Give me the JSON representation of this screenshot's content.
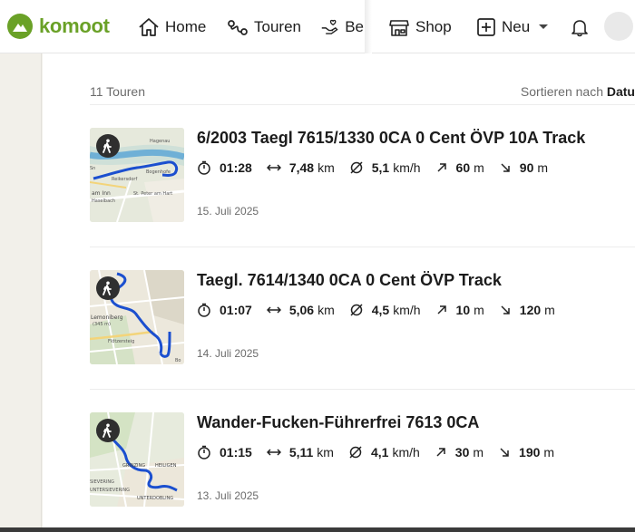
{
  "nav": {
    "brand": "komoot",
    "home": "Home",
    "touren": "Touren",
    "be": "Be",
    "shop": "Shop",
    "neu": "Neu"
  },
  "list": {
    "count": "11 Touren",
    "sort_label": "Sortieren nach",
    "sort_value": "Datu"
  },
  "tours": [
    {
      "title": "6/2003 Taegl 7615/1330 0CA 0 Cent ÖVP 10A Track",
      "duration": "01:28",
      "distance": "7,48",
      "distance_unit": "km",
      "speed": "5,1",
      "speed_unit": "km/h",
      "ascent": "60",
      "ascent_unit": "m",
      "descent": "90",
      "descent_unit": "m",
      "date": "15. Juli 2025",
      "map_labels": [
        "Hagenau",
        "Reikersdorf",
        "Bogenhofe",
        "am Inn",
        "Haselbach",
        "St. Peter am Hart",
        "Sn"
      ]
    },
    {
      "title": "Taegl. 7614/1340 0CA 0 Cent ÖVP Track",
      "duration": "01:07",
      "distance": "5,06",
      "distance_unit": "km",
      "speed": "4,5",
      "speed_unit": "km/h",
      "ascent": "10",
      "ascent_unit": "m",
      "descent": "120",
      "descent_unit": "m",
      "date": "14. Juli 2025",
      "map_labels": [
        "Lemoniberg",
        "(345 m)",
        "Flötzersteig",
        "Bo"
      ]
    },
    {
      "title": "Wander-Fucken-Führerfrei 7613 0CA",
      "duration": "01:15",
      "distance": "5,11",
      "distance_unit": "km",
      "speed": "4,1",
      "speed_unit": "km/h",
      "ascent": "30",
      "ascent_unit": "m",
      "descent": "190",
      "descent_unit": "m",
      "date": "13. Juli 2025",
      "map_labels": [
        "GRINZING",
        "HEILIGEN",
        "SIEVERING",
        "UNTERSIEVERING",
        "UNTERDOBLING"
      ]
    }
  ],
  "colors": {
    "brand": "#6aa127",
    "route": "#1b4fcf",
    "muted": "#6b6b6b"
  },
  "icons": [
    "home-icon",
    "route-icon",
    "community-icon",
    "shop-icon",
    "plus-box-icon",
    "chevron-down-icon",
    "bell-icon",
    "timer-icon",
    "distance-icon",
    "speed-icon",
    "ascent-icon",
    "descent-icon",
    "hiker-icon"
  ]
}
